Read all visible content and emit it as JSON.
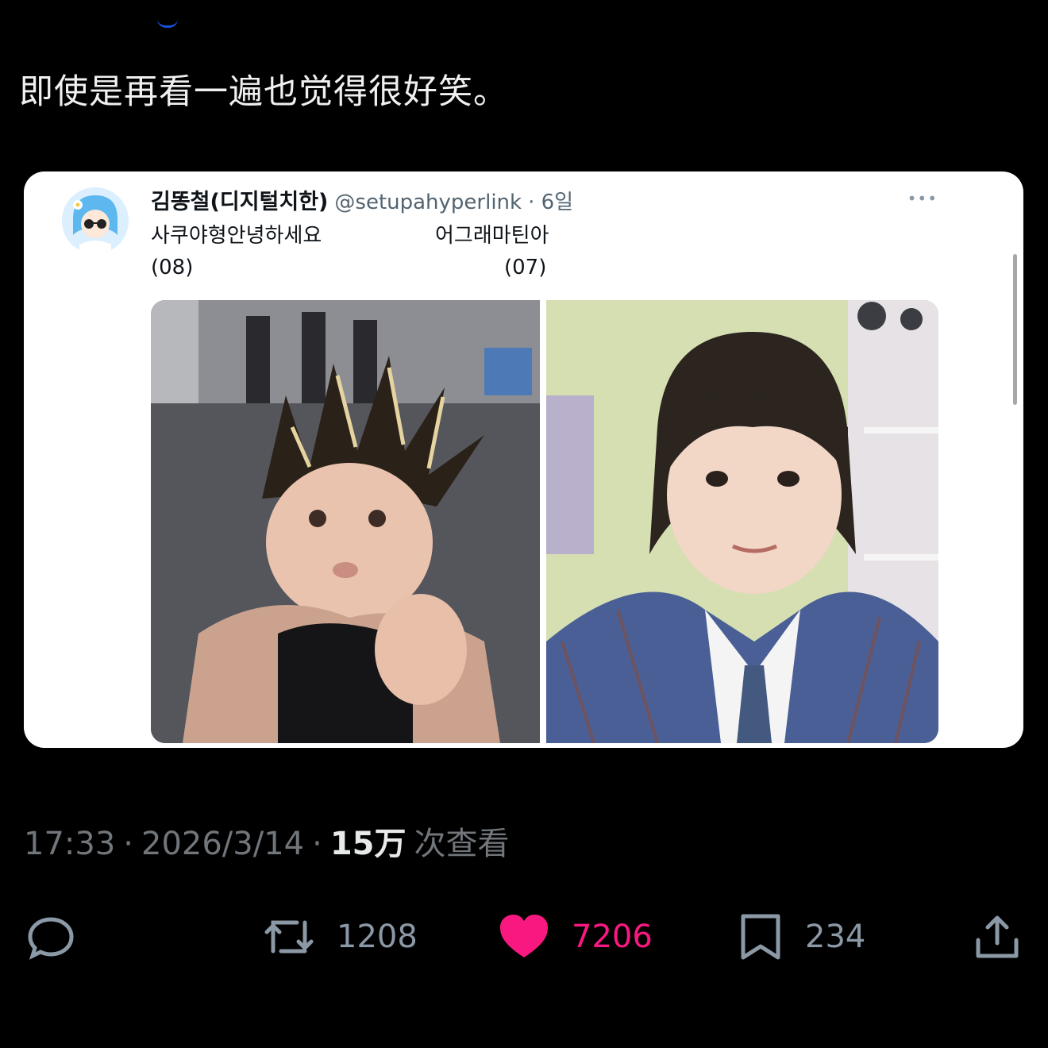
{
  "tweet": {
    "text": "即使是再看一遍也觉得很好笑。"
  },
  "quoted": {
    "author_name": "김똥철(디지털치한)",
    "handle": "@setupahyperlink",
    "time": "· 6일",
    "more_icon": "more-horizontal-icon",
    "left_caption": "사쿠야형안녕하세요",
    "left_year": "(08)",
    "right_caption": "어그래마틴아",
    "right_year": "(07)"
  },
  "meta": {
    "time": "17:33",
    "separator": "·",
    "date": "2026/3/14",
    "views_count": "15万",
    "views_label": "次查看"
  },
  "actions": {
    "reply_icon": "reply-icon",
    "retweet_count": "1208",
    "like_count": "7206",
    "bookmark_count": "234",
    "share_icon": "share-icon"
  },
  "colors": {
    "background": "#000000",
    "like": "#f91880",
    "muted": "#71767b",
    "card": "#ffffff"
  }
}
